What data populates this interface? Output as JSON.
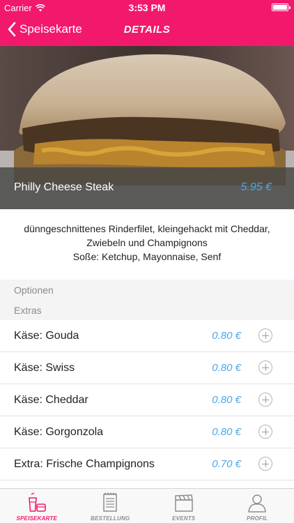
{
  "status_bar": {
    "carrier": "Carrier",
    "time": "3:53 PM"
  },
  "nav": {
    "back_label": "Speisekarte",
    "title": "DETAILS"
  },
  "dish": {
    "name": "Philly Cheese Steak",
    "price": "5.95 €"
  },
  "description": {
    "line1": "dünngeschnittenes Rinderfilet, kleingehackt mit Cheddar,",
    "line2": "Zwiebeln und Champignons",
    "line3": "Soße: Ketchup, Mayonnaise, Senf"
  },
  "sections": {
    "options": "Optionen",
    "extras": "Extras"
  },
  "extras": [
    {
      "label": "Käse: Gouda",
      "price": "0.80 €"
    },
    {
      "label": "Käse: Swiss",
      "price": "0.80 €"
    },
    {
      "label": "Käse: Cheddar",
      "price": "0.80 €"
    },
    {
      "label": "Käse: Gorgonzola",
      "price": "0.80 €"
    },
    {
      "label": "Extra: Frische Champignons",
      "price": "0.70 €"
    }
  ],
  "tabs": [
    {
      "label": "SPEISEKARTE",
      "icon": "drink-food-icon",
      "active": true
    },
    {
      "label": "BESTELLUNG",
      "icon": "notepad-icon",
      "active": false
    },
    {
      "label": "EVENTS",
      "icon": "clapperboard-icon",
      "active": false
    },
    {
      "label": "PROFIL",
      "icon": "person-icon",
      "active": false
    }
  ],
  "colors": {
    "brand": "#f2196d",
    "price": "#4aa7e8",
    "section_bg": "#f4f4f5",
    "tab_inactive": "#8e8e8e"
  }
}
